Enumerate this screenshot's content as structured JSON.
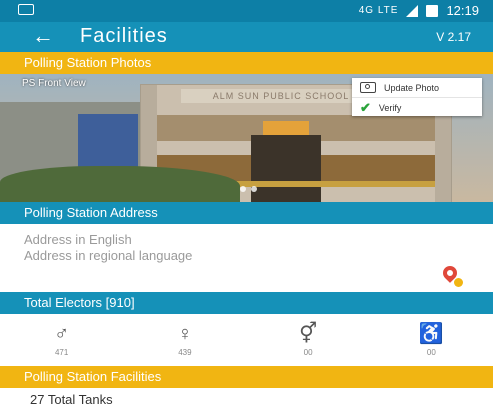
{
  "status_bar": {
    "network": "4G LTE",
    "time": "12:19"
  },
  "app_bar": {
    "title": "Facilities",
    "version": "V 2.17"
  },
  "sections": {
    "photos": "Polling Station Photos",
    "address": "Polling Station Address",
    "electors": "Total Electors [910]",
    "facilities": "Polling Station Facilities"
  },
  "photo": {
    "label": "PS Front View",
    "building_sign": "ALM SUN PUBLIC SCHOOL",
    "menu": {
      "update_photo": "Update Photo",
      "verify": "Verify"
    }
  },
  "address": {
    "english": "Address in English",
    "regional": "Address in regional language"
  },
  "electors": {
    "male": "471",
    "female": "439",
    "third_gender": "00",
    "pwd": "00"
  },
  "facilities": {
    "first_item": "27 Total Tanks"
  },
  "icons": {
    "back": "arrow-left-icon",
    "update_photo": "camera-icon",
    "verify": "checkmark-icon",
    "map": "map-pin-icon",
    "male": "male-icon",
    "female": "female-icon",
    "third_gender": "third-gender-icon",
    "pwd": "wheelchair-icon"
  },
  "colors": {
    "primary": "#1591b8",
    "status_bar": "#0d7fa6",
    "accent": "#f1b512"
  }
}
